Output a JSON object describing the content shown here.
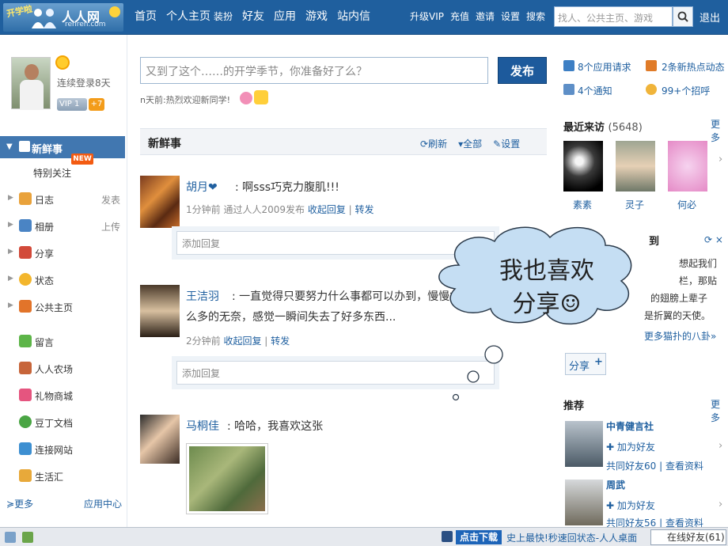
{
  "logo": {
    "badge": "开学啦",
    "brand": "人人网",
    "domain": "renren.com"
  },
  "nav": {
    "items": [
      "首页",
      "个人主页",
      "好友",
      "应用",
      "游戏",
      "站内信"
    ],
    "decorate": "装扮",
    "right": [
      "升级VIP",
      "充值",
      "邀请",
      "设置",
      "搜索"
    ],
    "search_placeholder": "找人、公共主页、游戏",
    "logout": "退出"
  },
  "profile": {
    "login_days": "连续登录8天",
    "vip": "VIP",
    "vip_level": "1",
    "bonus": "+7"
  },
  "sidebar": {
    "active": "新鲜事",
    "special_follow": "特别关注",
    "new_tag": "NEW",
    "items": [
      {
        "label": "日志",
        "action": "发表"
      },
      {
        "label": "相册",
        "action": "上传"
      },
      {
        "label": "分享",
        "action": ""
      },
      {
        "label": "状态",
        "action": ""
      },
      {
        "label": "公共主页",
        "action": ""
      },
      {
        "label": "留言",
        "action": ""
      },
      {
        "label": "人人农场",
        "action": ""
      },
      {
        "label": "礼物商城",
        "action": ""
      },
      {
        "label": "豆丁文档",
        "action": ""
      },
      {
        "label": "连接网站",
        "action": ""
      },
      {
        "label": "生活汇",
        "action": ""
      }
    ],
    "more": "更多",
    "app_center": "应用中心"
  },
  "composer": {
    "placeholder": "又到了这个……的开学季节，你准备好了么？",
    "publish": "发布",
    "hint": "n天前:热烈欢迎新同学!"
  },
  "feed": {
    "title": "新鲜事",
    "refresh": "刷新",
    "filter": "全部",
    "settings": "设置",
    "reply_placeholder": "添加回复",
    "posts": [
      {
        "name": "胡月❤",
        "text": ": 啊sss巧克力腹肌!!!",
        "meta": "1分钟前  通过人人2009发布",
        "collapse": "收起回复",
        "forward": "转发"
      },
      {
        "name": "王洁羽",
        "text_1": ": 一直觉得只要努力什么事都可以办到，慢慢才",
        "text_2": "么多的无奈，感觉一瞬间失去了好多东西...",
        "meta": "2分钟前",
        "collapse": "收起回复",
        "forward": "转发"
      },
      {
        "name": "马桐佳",
        "text": ": 哈哈，我喜欢这张"
      }
    ]
  },
  "right": {
    "app_requests": "8个应用请求",
    "hot_news": "2条新热点动态",
    "notices": "4个通知",
    "greetings": "99+个招呼",
    "recent_title": "最近来访",
    "recent_count": "(5648)",
    "more": "更多",
    "visitors": [
      "素素",
      "灵子",
      "何必"
    ],
    "gossip_title": "到",
    "gossip_lines": [
      "想起我们",
      "栏，那贴",
      "的翅膀上辈子",
      "是折翼的天使。"
    ],
    "gossip_more": "更多猫扑的八卦»",
    "share_label": "分享",
    "recommend_title": "推荐",
    "recommend": [
      {
        "name": "中青健言社",
        "add": "加为好友",
        "mutual": "共同好友60",
        "profile": "查看资料"
      },
      {
        "name": "周武",
        "add": "加为好友",
        "mutual": "共同好友56",
        "profile": "查看资料"
      }
    ]
  },
  "callout": {
    "line1": "我也喜欢",
    "line2": "分享☺"
  },
  "taskbar": {
    "download": "点击下载",
    "promo": "史上最快!秒速回状态-人人桌面",
    "online": "在线好友(61)"
  }
}
